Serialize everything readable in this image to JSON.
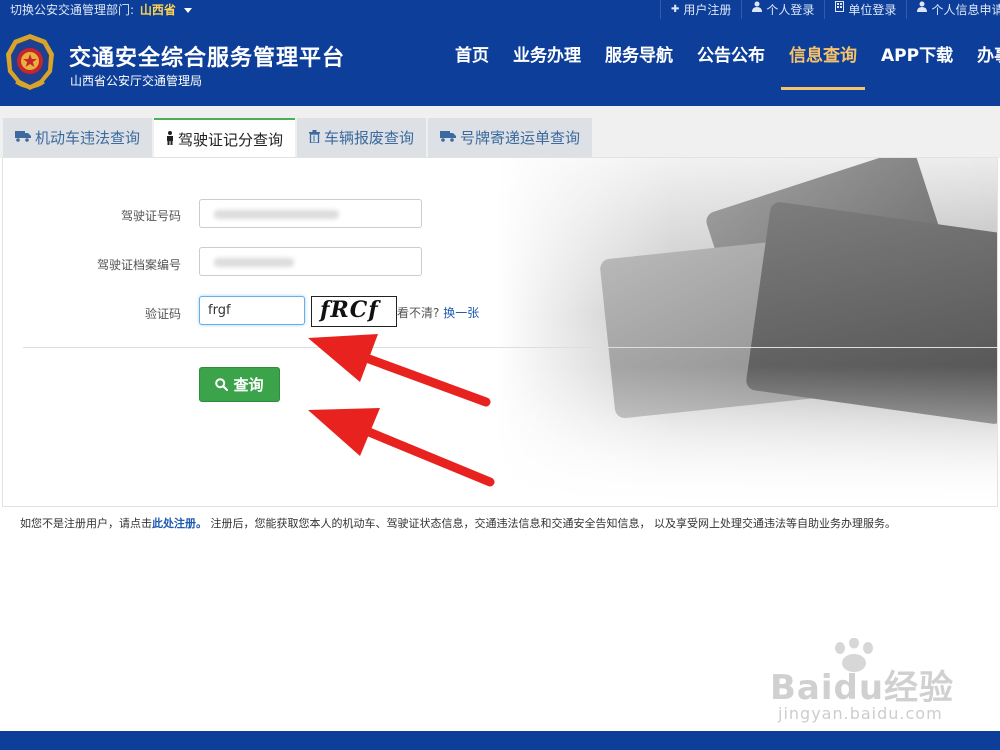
{
  "topbar": {
    "switch_label": "切换公安交通管理部门:",
    "province": "山西省",
    "links": [
      {
        "icon": "plus-icon",
        "label": "用户注册"
      },
      {
        "icon": "user-icon",
        "label": "个人登录"
      },
      {
        "icon": "building-icon",
        "label": "单位登录"
      },
      {
        "icon": "user-icon",
        "label": "个人信息申请"
      }
    ]
  },
  "header": {
    "title": "交通安全综合服务管理平台",
    "subtitle": "山西省公安厅交通管理局",
    "nav": [
      {
        "label": "首页",
        "active": false
      },
      {
        "label": "业务办理",
        "active": false
      },
      {
        "label": "服务导航",
        "active": false
      },
      {
        "label": "公告公布",
        "active": false
      },
      {
        "label": "信息查询",
        "active": true
      },
      {
        "label": "APP下载",
        "active": false
      },
      {
        "label": "办事",
        "active": false
      }
    ]
  },
  "tabs": [
    {
      "label": "机动车违法查询",
      "icon": "truck-icon",
      "active": false
    },
    {
      "label": "驾驶证记分查询",
      "icon": "person-icon",
      "active": true
    },
    {
      "label": "车辆报废查询",
      "icon": "trash-icon",
      "active": false
    },
    {
      "label": "号牌寄递运单查询",
      "icon": "truck-icon",
      "active": false
    }
  ],
  "form": {
    "license_number_label": "驾驶证号码",
    "file_number_label": "驾驶证档案编号",
    "captcha_label": "验证码",
    "captcha_value": "frgf",
    "captcha_image_text": "fRCf",
    "cant_see_text": "看不清?",
    "change_link": "换一张",
    "query_button": "查询"
  },
  "note": {
    "prefix": "如您不是注册用户，请点击",
    "register_link": "此处注册。",
    "suffix": " 注册后，您能获取您本人的机动车、驾驶证状态信息，交通违法信息和交通安全告知信息， 以及享受网上处理交通违法等自助业务办理服务。"
  },
  "watermark": {
    "main": "Baidu经验",
    "sub": "jingyan.baidu.com"
  },
  "colors": {
    "primary_blue": "#0d3f9a",
    "accent_gold": "#f6c26a",
    "query_green": "#3ba34a",
    "arrow_red": "#e8231f"
  }
}
